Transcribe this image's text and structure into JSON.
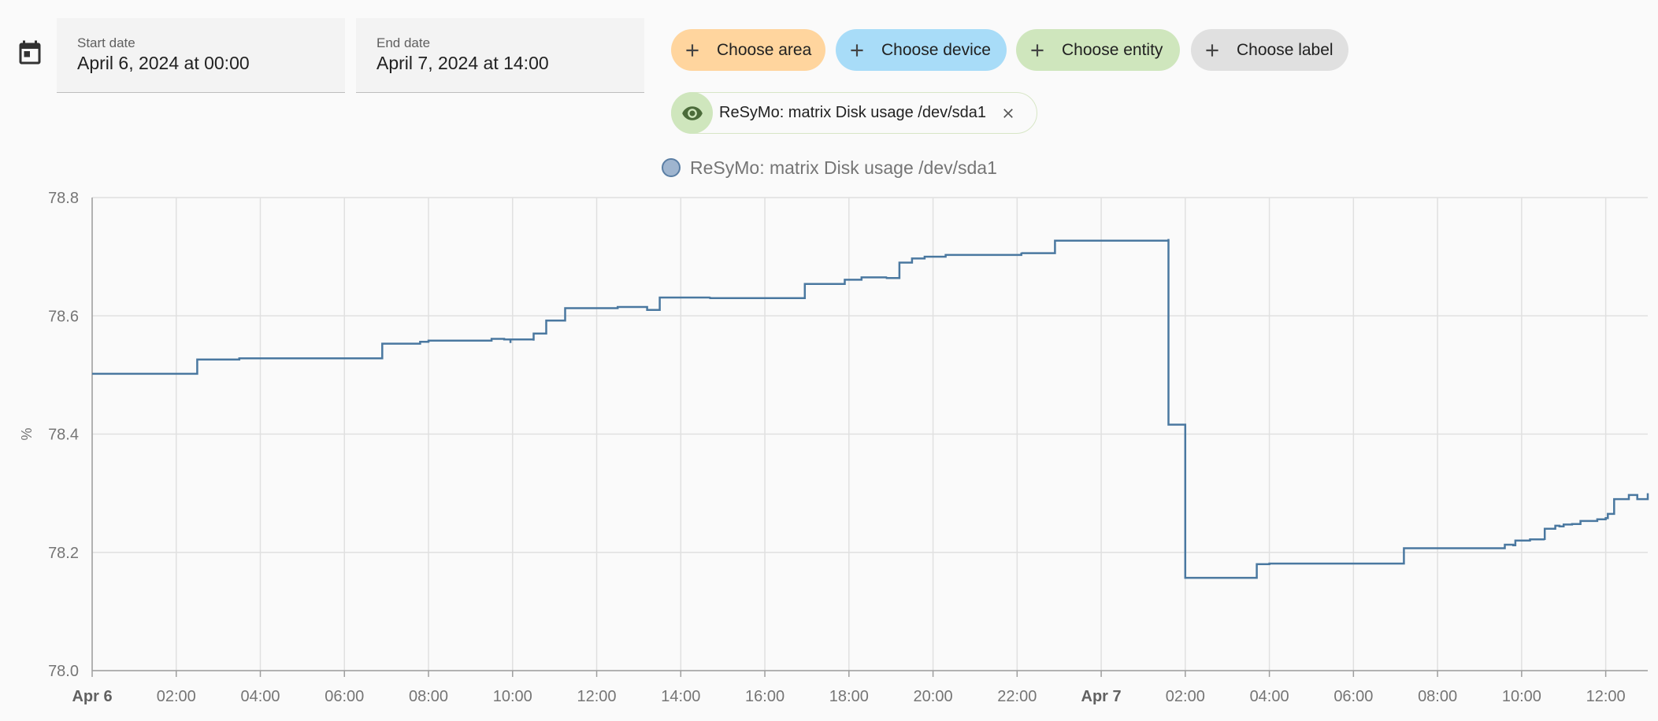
{
  "date_range": {
    "start_label": "Start date",
    "start_value": "April 6, 2024 at 00:00",
    "end_label": "End date",
    "end_value": "April 7, 2024 at 14:00"
  },
  "target_picker": {
    "area": "Choose area",
    "device": "Choose device",
    "entity": "Choose entity",
    "label": "Choose label",
    "colors": {
      "area": "#ffd59e",
      "device": "#a8dcf8",
      "entity": "#cfe6bd",
      "label": "#e0e0e0"
    }
  },
  "selected_entity": {
    "name": "ReSyMo: matrix Disk usage /dev/sda1"
  },
  "chart_data": {
    "type": "line",
    "step": true,
    "ylabel": "%",
    "ylim": [
      78.0,
      78.8
    ],
    "yticks": [
      "78.0",
      "78.2",
      "78.4",
      "78.6",
      "78.8"
    ],
    "x_domain_hours": [
      0,
      37
    ],
    "xticks": [
      {
        "h": 0,
        "label": "Apr 6",
        "bold": true
      },
      {
        "h": 2,
        "label": "02:00"
      },
      {
        "h": 4,
        "label": "04:00"
      },
      {
        "h": 6,
        "label": "06:00"
      },
      {
        "h": 8,
        "label": "08:00"
      },
      {
        "h": 10,
        "label": "10:00"
      },
      {
        "h": 12,
        "label": "12:00"
      },
      {
        "h": 14,
        "label": "14:00"
      },
      {
        "h": 16,
        "label": "16:00"
      },
      {
        "h": 18,
        "label": "18:00"
      },
      {
        "h": 20,
        "label": "20:00"
      },
      {
        "h": 22,
        "label": "22:00"
      },
      {
        "h": 24,
        "label": "Apr 7",
        "bold": true
      },
      {
        "h": 26,
        "label": "02:00"
      },
      {
        "h": 28,
        "label": "04:00"
      },
      {
        "h": 30,
        "label": "06:00"
      },
      {
        "h": 32,
        "label": "08:00"
      },
      {
        "h": 34,
        "label": "10:00"
      },
      {
        "h": 36,
        "label": "12:00"
      }
    ],
    "grid": true,
    "series": [
      {
        "name": "ReSyMo: matrix Disk usage /dev/sda1",
        "color": "#4a78a0",
        "points": [
          [
            0,
            78.502
          ],
          [
            2.5,
            78.506
          ],
          [
            2.5,
            78.526
          ],
          [
            3.5,
            78.528
          ],
          [
            6.9,
            78.534
          ],
          [
            6.9,
            78.553
          ],
          [
            7.8,
            78.556
          ],
          [
            8.0,
            78.558
          ],
          [
            9.5,
            78.561
          ],
          [
            9.8,
            78.56
          ],
          [
            9.95,
            78.554
          ],
          [
            9.95,
            78.56
          ],
          [
            10.5,
            78.558
          ],
          [
            10.5,
            78.57
          ],
          [
            10.8,
            78.571
          ],
          [
            10.8,
            78.592
          ],
          [
            11.25,
            78.593
          ],
          [
            11.25,
            78.613
          ],
          [
            12.5,
            78.615
          ],
          [
            13.2,
            78.614
          ],
          [
            13.2,
            78.61
          ],
          [
            13.5,
            78.61
          ],
          [
            13.5,
            78.631
          ],
          [
            14.7,
            78.632
          ],
          [
            14.7,
            78.63
          ],
          [
            16.95,
            78.631
          ],
          [
            16.95,
            78.654
          ],
          [
            17.9,
            78.656
          ],
          [
            17.9,
            78.661
          ],
          [
            18.3,
            78.662
          ],
          [
            18.3,
            78.665
          ],
          [
            18.9,
            78.666
          ],
          [
            18.9,
            78.664
          ],
          [
            19.2,
            78.665
          ],
          [
            19.2,
            78.69
          ],
          [
            19.5,
            78.692
          ],
          [
            19.5,
            78.697
          ],
          [
            19.8,
            78.698
          ],
          [
            19.8,
            78.7
          ],
          [
            20.3,
            78.701
          ],
          [
            20.3,
            78.703
          ],
          [
            22.1,
            78.707
          ],
          [
            22.1,
            78.706
          ],
          [
            22.9,
            78.707
          ],
          [
            22.9,
            78.727
          ],
          [
            25.6,
            78.73
          ],
          [
            25.6,
            78.416
          ],
          [
            26.0,
            78.416
          ],
          [
            26.0,
            78.157
          ],
          [
            27.7,
            78.16
          ],
          [
            27.7,
            78.18
          ],
          [
            28.0,
            78.181
          ],
          [
            28.5,
            78.181
          ],
          [
            31.2,
            78.185
          ],
          [
            31.2,
            78.207
          ],
          [
            33.6,
            78.211
          ],
          [
            33.6,
            78.213
          ],
          [
            33.8,
            78.212
          ],
          [
            33.85,
            78.22
          ],
          [
            34.2,
            78.222
          ],
          [
            34.55,
            78.221
          ],
          [
            34.55,
            78.24
          ],
          [
            34.8,
            78.245
          ],
          [
            34.9,
            78.244
          ],
          [
            35.0,
            78.247
          ],
          [
            35.2,
            78.248
          ],
          [
            35.4,
            78.253
          ],
          [
            35.7,
            78.253
          ],
          [
            35.8,
            78.256
          ],
          [
            36.0,
            78.258
          ],
          [
            36.05,
            78.265
          ],
          [
            36.2,
            78.266
          ],
          [
            36.2,
            78.29
          ],
          [
            36.55,
            78.291
          ],
          [
            36.55,
            78.297
          ],
          [
            36.75,
            78.297
          ],
          [
            36.75,
            78.29
          ],
          [
            37.0,
            78.3
          ]
        ]
      }
    ]
  }
}
